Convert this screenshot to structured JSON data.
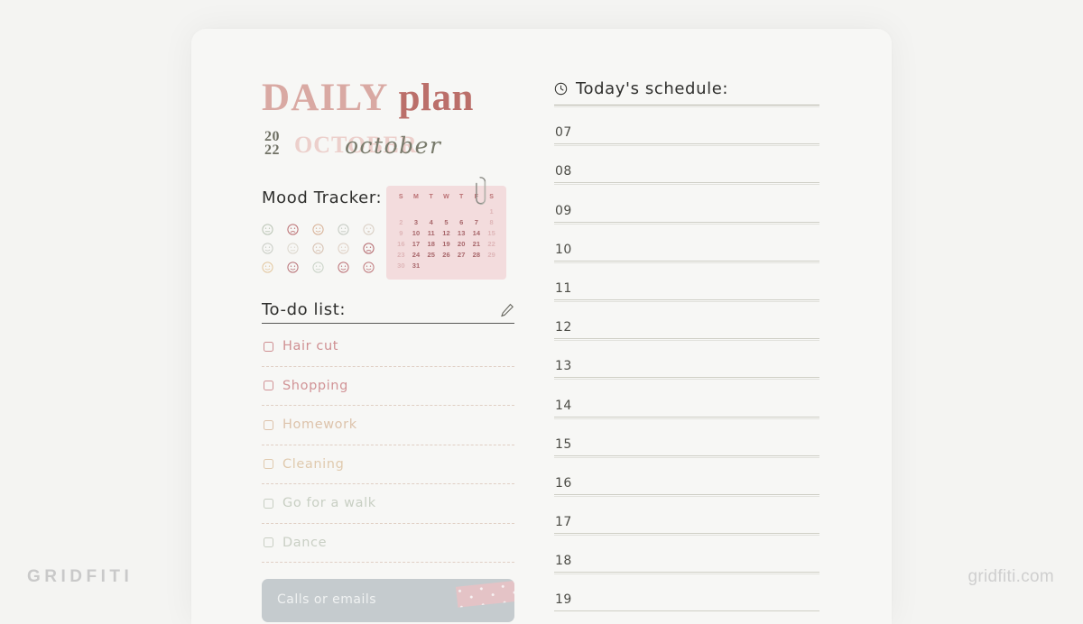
{
  "watermarks": {
    "left": "GRIDFITI",
    "right": "gridfiti.com"
  },
  "title": {
    "word1": "DAILY",
    "word2": "plan",
    "year_top": "20",
    "year_bottom": "22",
    "month_caps": "OCTOBER",
    "month_script": "october"
  },
  "mood_tracker": {
    "heading": "Mood Tracker:",
    "faces": [
      {
        "color": "#b9c4b4",
        "mood": "neutral-face-icon"
      },
      {
        "color": "#bb6f72",
        "mood": "sad-face-icon"
      },
      {
        "color": "#d7b095",
        "mood": "happy-face-icon"
      },
      {
        "color": "#c2c8c0",
        "mood": "neutral-face-icon"
      },
      {
        "color": "#d8cdc2",
        "mood": "surprised-face-icon"
      },
      {
        "color": "#c8ccc4",
        "mood": "happy-face-icon"
      },
      {
        "color": "#dcd7cd",
        "mood": "neutral-face-icon"
      },
      {
        "color": "#d6c0b0",
        "mood": "sad-face-icon"
      },
      {
        "color": "#ddcec2",
        "mood": "neutral-face-icon"
      },
      {
        "color": "#b3676c",
        "mood": "angry-face-icon"
      },
      {
        "color": "#e3c79f",
        "mood": "happy-face-icon"
      },
      {
        "color": "#b97479",
        "mood": "wink-face-icon"
      },
      {
        "color": "#c9d2c6",
        "mood": "neutral-face-icon"
      },
      {
        "color": "#bb7076",
        "mood": "happy-face-icon"
      },
      {
        "color": "#c07a7e",
        "mood": "happy-face-icon"
      }
    ]
  },
  "calendar": {
    "dow": [
      "S",
      "M",
      "T",
      "W",
      "T",
      "F",
      "S"
    ],
    "weeks": [
      [
        null,
        null,
        null,
        null,
        null,
        null,
        1
      ],
      [
        2,
        3,
        4,
        5,
        6,
        7,
        8
      ],
      [
        9,
        10,
        11,
        12,
        13,
        14,
        15
      ],
      [
        16,
        17,
        18,
        19,
        20,
        21,
        22
      ],
      [
        23,
        24,
        25,
        26,
        27,
        28,
        29
      ],
      [
        30,
        31,
        null,
        null,
        null,
        null,
        null
      ]
    ],
    "dim_days": [
      2,
      8,
      9,
      15,
      16,
      22,
      23,
      29,
      30,
      1
    ],
    "bg_color": "#f3dcdd",
    "accent_color": "#a8676b"
  },
  "todo": {
    "heading": "To-do list:",
    "pencil_icon": "pencil-icon",
    "items": [
      {
        "label": "Hair cut",
        "color": "#cf8f92"
      },
      {
        "label": "Shopping",
        "color": "#d19396"
      },
      {
        "label": "Homework",
        "color": "#ddc3ab"
      },
      {
        "label": "Cleaning",
        "color": "#e0caae"
      },
      {
        "label": "Go for a walk",
        "color": "#c8cfc3"
      },
      {
        "label": "Dance",
        "color": "#c9cfc4"
      }
    ]
  },
  "calls_box": {
    "label": "Calls or emails",
    "bg_color": "#c5cbce",
    "tape_color": "#e6c3c6"
  },
  "schedule": {
    "heading": "Today's schedule:",
    "clock_icon": "clock-icon",
    "hours": [
      "07",
      "08",
      "09",
      "10",
      "11",
      "12",
      "13",
      "14",
      "15",
      "16",
      "17",
      "18",
      "19"
    ]
  }
}
